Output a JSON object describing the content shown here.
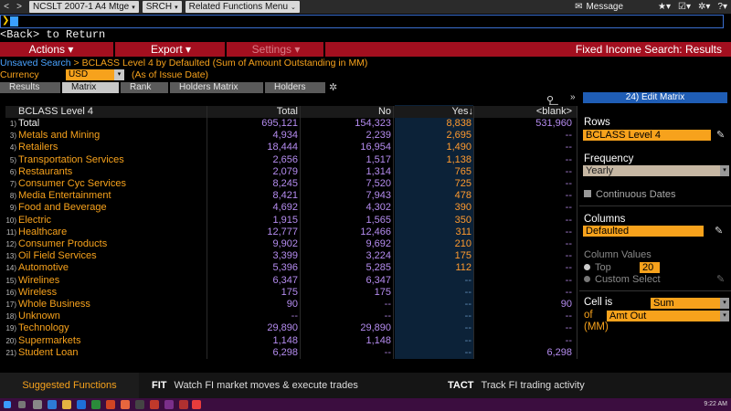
{
  "topbar": {
    "back_glyph": "<",
    "fwd_glyph": ">",
    "security": "NCSLT 2007-1 A4 Mtge",
    "function": "SRCH",
    "related": "Related Functions Menu",
    "message": "Message",
    "caret": "▾",
    "icons": [
      "star-icon",
      "checkbox-icon",
      "gear-icon",
      "help-icon"
    ]
  },
  "command": {
    "arrow": "❯"
  },
  "back_line": "<Back> to Return",
  "actions": {
    "actions_label": "Actions ▾",
    "export_label": "Export ▾",
    "settings_label": "Settings ▾",
    "title": "Fixed Income Search: Results"
  },
  "breadcrumb": {
    "link": "Unsaved Search",
    "sep": " > ",
    "text": "BCLASS Level 4 by Defaulted (Sum of Amount Outstanding in MM)"
  },
  "currency": {
    "label": "Currency",
    "value": "USD",
    "note": "(As of Issue Date)"
  },
  "tabs": [
    "Results",
    "Matrix",
    "Rank",
    "Holders Matrix",
    "Holders"
  ],
  "active_tab": "Matrix",
  "table": {
    "headers": {
      "label": "BCLASS Level 4",
      "total": "Total",
      "no": "No",
      "yes": "Yes↓",
      "blank": "<blank>"
    },
    "rows": [
      {
        "n": "1)",
        "label": "Total",
        "total": "695,121",
        "no": "154,323",
        "yes": "8,838",
        "blank": "531,960"
      },
      {
        "n": "3)",
        "label": "Metals and Mining",
        "total": "4,934",
        "no": "2,239",
        "yes": "2,695",
        "blank": "--"
      },
      {
        "n": "4)",
        "label": "Retailers",
        "total": "18,444",
        "no": "16,954",
        "yes": "1,490",
        "blank": "--"
      },
      {
        "n": "5)",
        "label": "Transportation Services",
        "total": "2,656",
        "no": "1,517",
        "yes": "1,138",
        "blank": "--"
      },
      {
        "n": "6)",
        "label": "Restaurants",
        "total": "2,079",
        "no": "1,314",
        "yes": "765",
        "blank": "--"
      },
      {
        "n": "7)",
        "label": "Consumer Cyc Services",
        "total": "8,245",
        "no": "7,520",
        "yes": "725",
        "blank": "--"
      },
      {
        "n": "8)",
        "label": "Media Entertainment",
        "total": "8,421",
        "no": "7,943",
        "yes": "478",
        "blank": "--"
      },
      {
        "n": "9)",
        "label": "Food and Beverage",
        "total": "4,692",
        "no": "4,302",
        "yes": "390",
        "blank": "--"
      },
      {
        "n": "10)",
        "label": "Electric",
        "total": "1,915",
        "no": "1,565",
        "yes": "350",
        "blank": "--"
      },
      {
        "n": "11)",
        "label": "Healthcare",
        "total": "12,777",
        "no": "12,466",
        "yes": "311",
        "blank": "--"
      },
      {
        "n": "12)",
        "label": "Consumer Products",
        "total": "9,902",
        "no": "9,692",
        "yes": "210",
        "blank": "--"
      },
      {
        "n": "13)",
        "label": "Oil Field Services",
        "total": "3,399",
        "no": "3,224",
        "yes": "175",
        "blank": "--"
      },
      {
        "n": "14)",
        "label": "Automotive",
        "total": "5,396",
        "no": "5,285",
        "yes": "112",
        "blank": "--"
      },
      {
        "n": "15)",
        "label": "Wirelines",
        "total": "6,347",
        "no": "6,347",
        "yes": "--",
        "blank": "--"
      },
      {
        "n": "16)",
        "label": "Wireless",
        "total": "175",
        "no": "175",
        "yes": "--",
        "blank": "--"
      },
      {
        "n": "17)",
        "label": "Whole Business",
        "total": "90",
        "no": "--",
        "yes": "--",
        "blank": "90"
      },
      {
        "n": "18)",
        "label": "Unknown",
        "total": "--",
        "no": "--",
        "yes": "--",
        "blank": "--"
      },
      {
        "n": "19)",
        "label": "Technology",
        "total": "29,890",
        "no": "29,890",
        "yes": "--",
        "blank": "--"
      },
      {
        "n": "20)",
        "label": "Supermarkets",
        "total": "1,148",
        "no": "1,148",
        "yes": "--",
        "blank": "--"
      },
      {
        "n": "21)",
        "label": "Student Loan",
        "total": "6,298",
        "no": "--",
        "yes": "--",
        "blank": "6,298"
      }
    ]
  },
  "panel": {
    "chevron": "»",
    "title": "24) Edit Matrix",
    "rows_label": "Rows",
    "rows_value": "BCLASS Level 4",
    "frequency_label": "Frequency",
    "frequency_value": "Yearly",
    "continuous_dates": "Continuous Dates",
    "columns_label": "Columns",
    "columns_value": "Defaulted",
    "column_values_label": "Column Values",
    "top_label": "Top",
    "top_value": "20",
    "custom_select": "Custom Select",
    "cell_is_label": "Cell is",
    "cell_is_value": "Sum",
    "of_label": "of",
    "of_value": "Amt Out",
    "unit": "(MM)"
  },
  "bottom": {
    "suggested": "Suggested Functions",
    "items": [
      {
        "code": "FIT",
        "text": "Watch FI market moves & execute trades"
      },
      {
        "code": "TACT",
        "text": "Track FI trading activity"
      }
    ]
  },
  "taskbar": {
    "time": "9:22 AM"
  }
}
